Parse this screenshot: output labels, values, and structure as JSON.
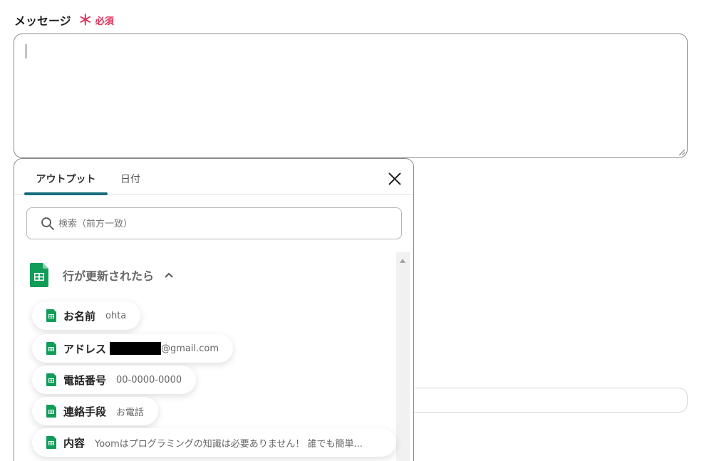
{
  "field": {
    "label": "メッセージ",
    "required_mark": "＊",
    "required_text": "必須",
    "value": ""
  },
  "popup": {
    "tabs": [
      {
        "label": "アウトプット",
        "active": true
      },
      {
        "label": "日付",
        "active": false
      }
    ],
    "close_icon": "close-icon",
    "search": {
      "placeholder": "検索（前方一致）",
      "value": ""
    },
    "group": {
      "icon": "google-sheets-icon",
      "title": "行が更新されたら",
      "expanded": true
    },
    "items": [
      {
        "name": "お名前",
        "value": "ohta"
      },
      {
        "name": "アドレス",
        "value": "@gmail.com",
        "redacted_prefix": true
      },
      {
        "name": "電話番号",
        "value": "00-0000-0000"
      },
      {
        "name": "連絡手段",
        "value": "お電話"
      },
      {
        "name": "内容",
        "value": "Yoomはプログラミングの知識は必要ありません！ 誰でも簡単..."
      }
    ]
  },
  "colors": {
    "accent": "#176d7c",
    "required": "#e0335a",
    "sheets_green": "#0f9d58"
  }
}
